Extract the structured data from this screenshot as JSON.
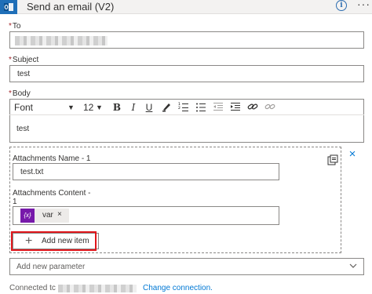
{
  "header": {
    "title": "Send an email (V2)",
    "app_icon": "outlook-icon",
    "info_icon": "info-icon",
    "more_icon": "more-icon",
    "info_glyph": "i",
    "more_glyph": "···"
  },
  "to": {
    "label": "To",
    "value": ""
  },
  "subject": {
    "label": "Subject",
    "value": "test"
  },
  "body": {
    "label": "Body",
    "value": "test",
    "toolbar": {
      "font": "Font",
      "size": "12",
      "bold": "B",
      "italic": "I",
      "underline": "U"
    }
  },
  "attachments": {
    "name_label": "Attachments Name - 1",
    "name_value": "test.txt",
    "content_label_line1": "Attachments Content -",
    "content_label_line2": "1",
    "content_token": {
      "icon_text": "{x}",
      "text": "var",
      "remove": "×"
    },
    "add_item_label": "Add new item",
    "add_item_glyph": "+",
    "remove_glyph": "×"
  },
  "add_parameter": {
    "placeholder": "Add new parameter"
  },
  "footer": {
    "connected_prefix": "Connected tc",
    "change_link": "Change connection."
  },
  "colors": {
    "accent": "#0078d4",
    "token": "#7719aa",
    "highlight": "#e0161b",
    "required": "#a4262c"
  }
}
